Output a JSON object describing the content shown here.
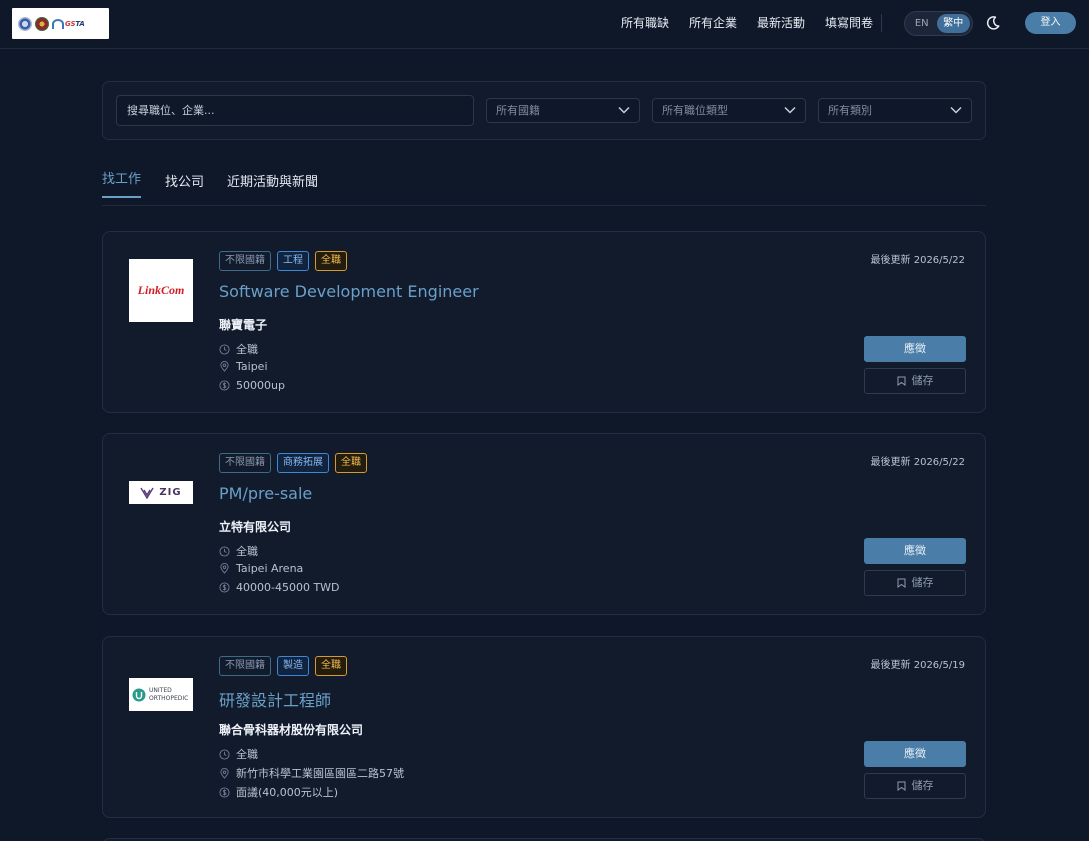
{
  "header": {
    "logo_text_gs": "GS",
    "logo_text_ta": "TA",
    "nav": [
      "所有職缺",
      "所有企業",
      "最新活動",
      "填寫問卷"
    ],
    "lang_en": "EN",
    "lang_zh": "繁中",
    "login": "登入"
  },
  "search": {
    "placeholder": "搜尋職位、企業...",
    "nationality": "所有國籍",
    "job_type": "所有職位類型",
    "category": "所有類別"
  },
  "tabs": [
    "找工作",
    "找公司",
    "近期活動與新聞"
  ],
  "jobs": [
    {
      "tags": [
        "不限國籍",
        "工程",
        "全職"
      ],
      "title": "Software Development Engineer",
      "company": "聯寶電子",
      "employment": "全職",
      "location": "Taipei",
      "salary": "50000up",
      "updated": "最後更新 2026/5/22",
      "apply": "應徵",
      "save": "儲存",
      "logo_text": "LinkCom"
    },
    {
      "tags": [
        "不限國籍",
        "商務拓展",
        "全職"
      ],
      "title": "PM/pre-sale",
      "company": "立特有限公司",
      "employment": "全職",
      "location": "Taipei Arena",
      "salary": "40000-45000 TWD",
      "updated": "最後更新 2026/5/22",
      "apply": "應徵",
      "save": "儲存",
      "logo_text": "ZIG"
    },
    {
      "tags": [
        "不限國籍",
        "製造",
        "全職"
      ],
      "title": "研發設計工程師",
      "company": "聯合骨科器材股份有限公司",
      "employment": "全職",
      "location": "新竹市科學工業園區園區二路57號",
      "salary": "面議(40,000元以上)",
      "updated": "最後更新 2026/5/19",
      "apply": "應徵",
      "save": "儲存",
      "logo_text_1": "UNITED",
      "logo_text_2": "ORTHOPEDIC"
    }
  ],
  "colors": {
    "background": "#0f1829",
    "accent": "#4a7ea8",
    "title": "#6aa0c8",
    "tag_amber": "#f2b94a",
    "tag_blue": "#8ab8f0"
  }
}
